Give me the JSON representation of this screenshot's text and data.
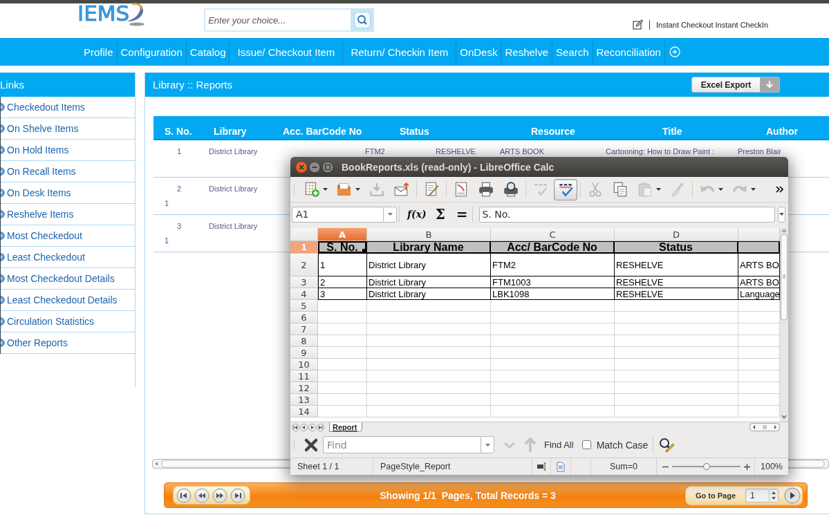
{
  "header": {
    "logo": "IEMS",
    "search": {
      "placeholder": "Enter your choice..."
    },
    "links": [
      "Instant Checkout",
      "Instant CheckIn"
    ]
  },
  "nav": {
    "items": [
      "Profile",
      "Configuration",
      "Catalog",
      "Issue/ Checkout Item",
      "Return/ Checkin Item",
      "OnDesk",
      "Reshelve",
      "Search",
      "Reconciliation"
    ]
  },
  "sidebar": {
    "title": "Links",
    "items": [
      "Checkedout Items",
      "On Shelve Items",
      "On Hold Items",
      "On Recall Items",
      "On Desk Items",
      "Reshelve Items",
      "Most Checkedout",
      "Least Checkedout",
      "Most Checkedout Details",
      "Least Checkedout Details",
      "Circulation Statistics",
      "Other Reports"
    ]
  },
  "report": {
    "title": "Library :: Reports",
    "export_button": "Excel Export",
    "table": {
      "columns": [
        "S. No.",
        "Library",
        "Acc. BarCode No",
        "Status",
        "Resource",
        "Title",
        "Author"
      ],
      "rows": [
        {
          "cells": [
            "1",
            "District Library",
            "FTM2",
            "RESHELVE",
            "ARTS BOOK",
            "Cartooning: How to Draw Paint :",
            "Preston Blair"
          ]
        },
        {
          "cells": [
            "2",
            "District Library"
          ],
          "note": "1"
        },
        {
          "cells": [
            "3",
            "District Library"
          ],
          "note": "1"
        }
      ]
    },
    "pager": {
      "status": "Showing 1/1  Pages, Total Records = 3",
      "goto_label": "Go to Page",
      "page": "1"
    }
  },
  "calc": {
    "title": "BookReports.xls (read-only) - LibreOffice Calc",
    "toolbar": [
      {
        "kind": "new",
        "disabled": false,
        "on": false
      },
      {
        "kind": "open",
        "disabled": false,
        "on": false
      },
      {
        "kind": "save",
        "disabled": true,
        "on": false
      },
      {
        "kind": "email",
        "disabled": false,
        "on": false
      },
      {
        "kind": "edit",
        "disabled": false,
        "on": false
      },
      {
        "kind": "pdf",
        "disabled": false,
        "on": false
      },
      {
        "kind": "print",
        "disabled": false,
        "on": false
      },
      {
        "kind": "preview",
        "disabled": false,
        "on": false
      },
      {
        "kind": "spellcheck",
        "disabled": true,
        "on": false
      },
      {
        "kind": "autospell",
        "disabled": false,
        "on": true
      },
      {
        "kind": "cut",
        "disabled": true,
        "on": false
      },
      {
        "kind": "copy",
        "disabled": false,
        "on": false
      },
      {
        "kind": "paste",
        "disabled": true,
        "on": false
      },
      {
        "kind": "brush",
        "disabled": true,
        "on": false
      },
      {
        "kind": "undo",
        "disabled": true,
        "on": false
      },
      {
        "kind": "redo",
        "disabled": true,
        "on": false
      }
    ],
    "name_box": "A1",
    "formula_buttons": [
      "f(x)",
      "Σ",
      "="
    ],
    "formula": "S. No.",
    "sheet": {
      "columns": [
        {
          "label": "A",
          "selected": true
        },
        {
          "label": "B",
          "selected": false
        },
        {
          "label": "C",
          "selected": false
        },
        {
          "label": "D",
          "selected": false
        },
        {
          "selected": false
        }
      ],
      "rows": [
        {
          "label": "1",
          "selected": true,
          "kind": "heading",
          "cells": [
            "S. No.",
            "Library Name",
            "Acc/ BarCode No",
            "Status"
          ]
        },
        {
          "label": "2",
          "selected": false,
          "kind": "data",
          "cells": [
            "1",
            "District Library",
            "FTM2",
            "RESHELVE",
            "ARTS BO"
          ]
        },
        {
          "label": "3",
          "selected": false,
          "kind": "data",
          "cells": [
            "2",
            "District Library",
            "FTM1003",
            "RESHELVE",
            "ARTS BO"
          ]
        },
        {
          "label": "4",
          "selected": false,
          "kind": "data",
          "cells": [
            "3",
            "District Library",
            "LBK1098",
            "RESHELVE",
            "Language"
          ]
        },
        {
          "label": "5",
          "selected": false,
          "kind": "empty"
        },
        {
          "label": "6",
          "selected": false,
          "kind": "empty"
        },
        {
          "label": "7",
          "selected": false,
          "kind": "empty"
        },
        {
          "label": "8",
          "selected": false,
          "kind": "empty"
        },
        {
          "label": "9",
          "selected": false,
          "kind": "empty"
        },
        {
          "label": "10",
          "selected": false,
          "kind": "empty"
        },
        {
          "label": "11",
          "selected": false,
          "kind": "empty"
        },
        {
          "label": "12",
          "selected": false,
          "kind": "empty"
        },
        {
          "label": "13",
          "selected": false,
          "kind": "empty"
        },
        {
          "label": "14",
          "selected": false,
          "kind": "empty"
        }
      ]
    },
    "sheet_tabs": [
      {
        "label": "Report",
        "selected": true
      }
    ],
    "find": {
      "placeholder": "Find",
      "buttons": [
        {
          "kind": "next",
          "disabled": true
        },
        {
          "kind": "previous",
          "disabled": true
        }
      ],
      "find_all": "Find All",
      "match_case": {
        "label": "Match Case",
        "checked": false
      }
    },
    "status_bar": {
      "sheet": "Sheet 1 / 1",
      "page_style": "PageStyle_Report",
      "sum": "Sum=0",
      "zoom": {
        "level": 0.5,
        "reading": "100%"
      }
    }
  }
}
